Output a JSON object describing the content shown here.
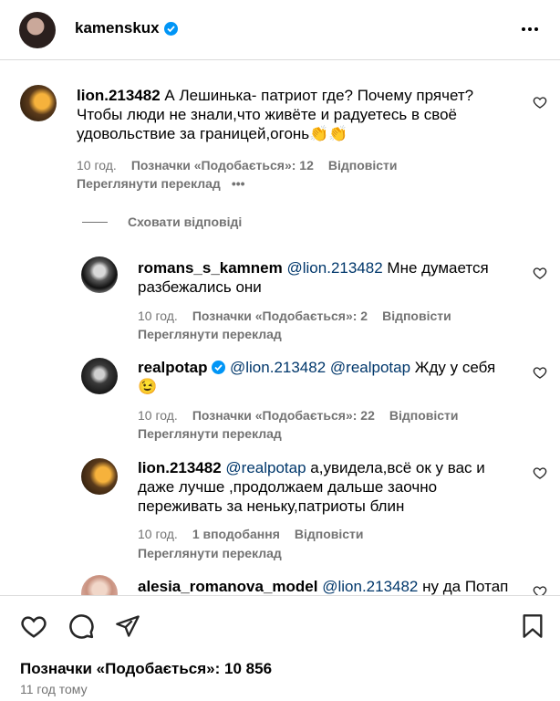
{
  "header": {
    "username": "kamenskux"
  },
  "comments": [
    {
      "username": "lion.213482",
      "text_lines": [
        "А Лешинька- патриот где? Почему прячет?",
        "Чтобы люди не знали,что живёте и радуетесь в своё",
        "удовольствие за границей,огонь👏👏"
      ],
      "time": "10 год.",
      "likes": "Позначки «Подобається»: 12",
      "reply": "Відповісти",
      "translate": "Переглянути переклад",
      "more": "•••"
    }
  ],
  "hide_replies": "Сховати відповіді",
  "replies": [
    {
      "username": "romans_s_kamnem",
      "mention": "@lion.213482",
      "line1": "Мне думается",
      "line2": "разбежались они",
      "time": "10 год.",
      "likes": "Позначки «Подобається»: 2",
      "reply": "Відповісти",
      "translate": "Переглянути переклад"
    },
    {
      "username": "realpotap",
      "mention": "@lion.213482",
      "mention2": "@realpotap",
      "line1": "Жду у себя",
      "line2": "😉",
      "time": "10 год.",
      "likes": "Позначки «Подобається»: 22",
      "reply": "Відповісти",
      "translate": "Переглянути переклад"
    },
    {
      "username": "lion.213482",
      "mention": "@realpotap",
      "line1": "а,увидела,всё ок у вас и",
      "line2": "даже лучше ,продолжаем дальше заочно",
      "line3": "переживать за неньку,патриоты блин",
      "time": "10 год.",
      "likes": "1 вподобання",
      "reply": "Відповісти",
      "translate": "Переглянути переклад"
    },
    {
      "username": "alesia_romanova_model",
      "mention": "@lion.213482",
      "line1": "ну да Потап"
    }
  ],
  "footer": {
    "likes": "Позначки «Подобається»: 10 856",
    "time": "11 год тому"
  }
}
